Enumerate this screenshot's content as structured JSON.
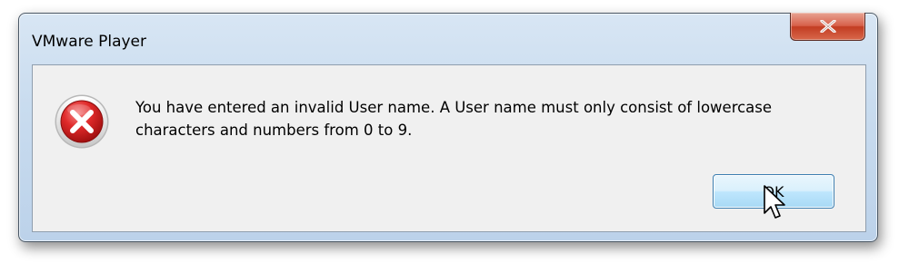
{
  "window": {
    "title": "VMware Player"
  },
  "titlebar": {
    "close_icon": "close-icon"
  },
  "dialog": {
    "icon": "error-icon",
    "message": "You have entered an invalid User name. A User name must only consist of lowercase characters and numbers from 0 to 9.",
    "ok_label": "OK"
  },
  "cursor": {
    "icon": "mouse-pointer-icon"
  },
  "colors": {
    "frame": "#c9dcef",
    "close_button": "#c94a31",
    "error_red": "#d62a2a",
    "content_bg": "#f0f0f0",
    "ok_button_border": "#3c7fb1"
  }
}
